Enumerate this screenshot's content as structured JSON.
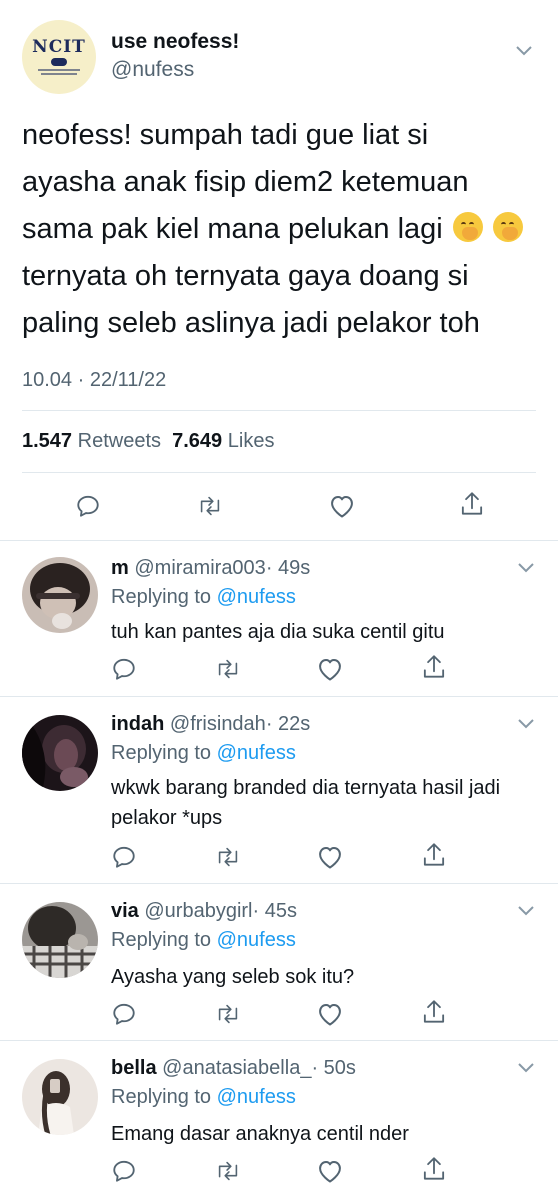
{
  "tweet": {
    "avatar_text": "NCIT",
    "name": "use neofess!",
    "handle": "@nufess",
    "text_lines": [
      "neofess! sumpah tadi gue liat si",
      "ayasha anak fisip diem2 ketemuan",
      "sama pak kiel mana pelukan lagi",
      "ternyata oh ternyata gaya doang si",
      "paling seleb aslinya jadi pelakor toh"
    ],
    "emoji": "face-with-hand-over-mouth",
    "timestamp": "10.04 · 22/11/22",
    "retweets_count": "1.547",
    "retweets_label": "Retweets",
    "likes_count": "7.649",
    "likes_label": "Likes"
  },
  "replies": [
    {
      "name": "m",
      "handle": "@miramira003",
      "time": "· 49s",
      "replying_prefix": "Replying to",
      "replying_to": "@nufess",
      "text": "tuh kan pantes aja dia suka centil gitu",
      "avatar_color": "#b7aba4"
    },
    {
      "name": "indah",
      "handle": "@frisindah",
      "time": "· 22s",
      "replying_prefix": "Replying to",
      "replying_to": "@nufess",
      "text": "wkwk barang branded dia ternyata hasil jadi pelakor *ups",
      "avatar_color": "#2d1f2a"
    },
    {
      "name": "via",
      "handle": "@urbabygirl",
      "time": "· 45s",
      "replying_prefix": "Replying to",
      "replying_to": "@nufess",
      "text": "Ayasha yang seleb sok itu?",
      "avatar_color": "#8a8682"
    },
    {
      "name": "bella",
      "handle": "@anatasiabella_",
      "time": "· 50s",
      "replying_prefix": "Replying to",
      "replying_to": "@nufess",
      "text": "Emang dasar anaknya centil nder",
      "avatar_color": "#e6ddd6"
    }
  ],
  "icons": {
    "reply": "reply-icon",
    "retweet": "retweet-icon",
    "like": "like-icon",
    "share": "share-icon",
    "more": "chevron-down-icon"
  },
  "colors": {
    "text": "#0f1419",
    "secondary": "#536471",
    "link": "#1d9bf0",
    "divider": "#e1e8ed"
  }
}
